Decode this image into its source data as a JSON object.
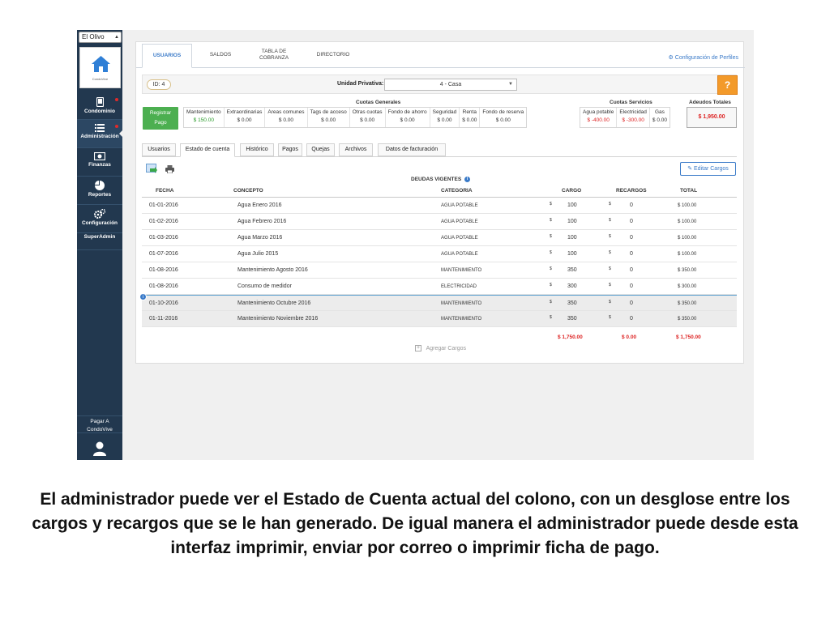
{
  "sidebar": {
    "building_select": "El Olivo",
    "logo_text": "CondoVive",
    "items": [
      {
        "label": "Condominio",
        "icon": "mobile-device-icon"
      },
      {
        "label": "Administración",
        "icon": "list-icon"
      },
      {
        "label": "Finanzas",
        "icon": "money-icon"
      },
      {
        "label": "Reportes",
        "icon": "pie-chart-icon"
      },
      {
        "label": "Configuración",
        "icon": "gears-icon"
      }
    ],
    "superadmin": "SuperAdmin",
    "pay_line1": "Pagar A",
    "pay_line2": "CondoVive"
  },
  "top_tabs": {
    "usuarios": "USUARIOS",
    "saldos": "SALDOS",
    "tabla_line1": "TABLA DE",
    "tabla_line2": "COBRANZA",
    "directorio": "DIRECTORIO"
  },
  "config_profiles": "Configuración de Perfiles",
  "unit_bar": {
    "id_badge": "ID: 4",
    "label": "Unidad Privativa:",
    "selected": "4 - Casa",
    "help": "?"
  },
  "sections": {
    "general": "Cuotas Generales",
    "services": "Cuotas Servicios",
    "owed": "Adeudos Totales"
  },
  "register_btn": {
    "line1": "Registrar",
    "line2": "Pago"
  },
  "general_fees": [
    {
      "label": "Mantenimiento",
      "value": "$ 150.00"
    },
    {
      "label": "Extraordinarias",
      "value": "$ 0.00"
    },
    {
      "label": "Areas comunes",
      "value": "$ 0.00"
    },
    {
      "label": "Tags de acceso",
      "value": "$ 0.00"
    },
    {
      "label": "Otras cuotas",
      "value": "$ 0.00"
    },
    {
      "label": "Fondo de ahorro",
      "value": "$ 0.00"
    },
    {
      "label": "Seguridad",
      "value": "$ 0.00"
    },
    {
      "label": "Renta",
      "value": "$ 0.00"
    },
    {
      "label": "Fondo de reserva",
      "value": "$ 0.00"
    }
  ],
  "service_fees": [
    {
      "label": "Agua potable",
      "value": "$ -400.00"
    },
    {
      "label": "Electricidad",
      "value": "$ -300.00"
    },
    {
      "label": "Gas",
      "value": "$ 0.00"
    }
  ],
  "total_owed": "$ 1,950.00",
  "sub_tabs": [
    "Usuarios",
    "Estado de cuenta",
    "Histórico",
    "Pagos",
    "Quejas",
    "Archivos",
    "Datos de facturación"
  ],
  "edit_btn": "Editar Cargos",
  "debts_title": "DEUDAS VIGENTES",
  "table": {
    "headers": [
      "FECHA",
      "CONCEPTO",
      "CATEGORIA",
      "CARGO",
      "RECARGOS",
      "TOTAL"
    ],
    "currency": "$",
    "rows": [
      {
        "fecha": "01-01-2016",
        "concepto": "Agua Enero 2016",
        "categoria": "AGUA POTABLE",
        "cargo": "100",
        "recargos": "0",
        "total": "$ 100.00"
      },
      {
        "fecha": "01-02-2016",
        "concepto": "Agua Febrero 2016",
        "categoria": "AGUA POTABLE",
        "cargo": "100",
        "recargos": "0",
        "total": "$ 100.00"
      },
      {
        "fecha": "01-03-2016",
        "concepto": "Agua Marzo 2016",
        "categoria": "AGUA POTABLE",
        "cargo": "100",
        "recargos": "0",
        "total": "$ 100.00"
      },
      {
        "fecha": "01-07-2016",
        "concepto": "Agua Julio 2015",
        "categoria": "AGUA POTABLE",
        "cargo": "100",
        "recargos": "0",
        "total": "$ 100.00"
      },
      {
        "fecha": "01-08-2016",
        "concepto": "Mantenimiento Agosto 2016",
        "categoria": "MANTENIMIENTO",
        "cargo": "350",
        "recargos": "0",
        "total": "$ 350.00"
      },
      {
        "fecha": "01-08-2016",
        "concepto": "Consumo de medidor",
        "categoria": "ELECTRICIDAD",
        "cargo": "300",
        "recargos": "0",
        "total": "$ 300.00"
      },
      {
        "fecha": "01-10-2016",
        "concepto": "Mantenimiento Octubre 2016",
        "categoria": "MANTENIMIENTO",
        "cargo": "350",
        "recargos": "0",
        "total": "$ 350.00"
      },
      {
        "fecha": "01-11-2016",
        "concepto": "Mantenimiento Noviembre 2016",
        "categoria": "MANTENIMIENTO",
        "cargo": "350",
        "recargos": "0",
        "total": "$ 350.00"
      }
    ],
    "totals": {
      "cargo": "$ 1,750.00",
      "recargos": "$ 0.00",
      "total": "$ 1,750.00"
    }
  },
  "add_charges": "Agregar Cargos",
  "caption": "El administrador puede ver el Estado de Cuenta actual del colono, con un desglose entre los cargos y recargos que se le han generado. De igual manera el administrador puede desde esta interfaz imprimir, enviar por correo o imprimir ficha de pago.",
  "colors": {
    "sidebar": "#22384f",
    "accent": "#3a7ac8",
    "register": "#4caf50",
    "help": "#f39a2a",
    "negative": "#dd2222"
  }
}
